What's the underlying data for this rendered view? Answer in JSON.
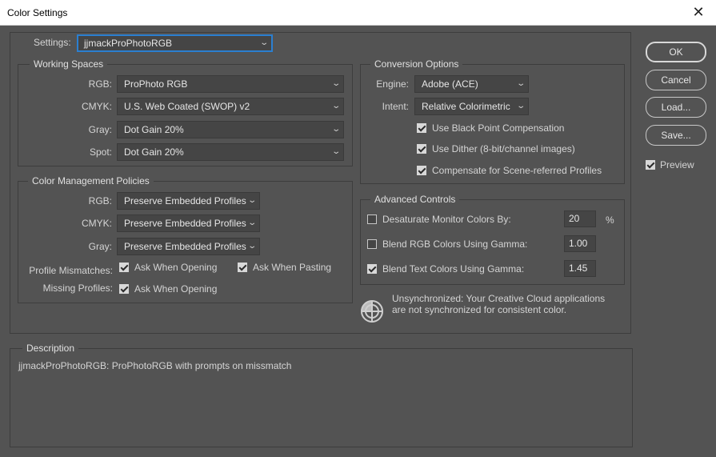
{
  "window": {
    "title": "Color Settings",
    "close_glyph": "✕"
  },
  "settings": {
    "label": "Settings:",
    "value": "jjmackProPhotoRGB"
  },
  "working_spaces": {
    "legend": "Working Spaces",
    "rows": [
      {
        "label": "RGB:",
        "value": "ProPhoto RGB"
      },
      {
        "label": "CMYK:",
        "value": "U.S. Web Coated (SWOP) v2"
      },
      {
        "label": "Gray:",
        "value": "Dot Gain 20%"
      },
      {
        "label": "Spot:",
        "value": "Dot Gain 20%"
      }
    ]
  },
  "policies": {
    "legend": "Color Management Policies",
    "rows": [
      {
        "label": "RGB:",
        "value": "Preserve Embedded Profiles"
      },
      {
        "label": "CMYK:",
        "value": "Preserve Embedded Profiles"
      },
      {
        "label": "Gray:",
        "value": "Preserve Embedded Profiles"
      }
    ],
    "mismatch_label": "Profile Mismatches:",
    "mismatch_opening": {
      "label": "Ask When Opening",
      "checked": true
    },
    "mismatch_pasting": {
      "label": "Ask When Pasting",
      "checked": true
    },
    "missing_label": "Missing Profiles:",
    "missing_opening": {
      "label": "Ask When Opening",
      "checked": true
    }
  },
  "conversion": {
    "legend": "Conversion Options",
    "engine_label": "Engine:",
    "engine_value": "Adobe (ACE)",
    "intent_label": "Intent:",
    "intent_value": "Relative Colorimetric",
    "black_point": {
      "label": "Use Black Point Compensation",
      "checked": true
    },
    "dither": {
      "label": "Use Dither (8-bit/channel images)",
      "checked": true
    },
    "scene": {
      "label": "Compensate for Scene-referred Profiles",
      "checked": true
    }
  },
  "advanced": {
    "legend": "Advanced Controls",
    "desaturate": {
      "label": "Desaturate Monitor Colors By:",
      "checked": false,
      "value": "20",
      "unit": "%"
    },
    "blend_rgb": {
      "label": "Blend RGB Colors Using Gamma:",
      "checked": false,
      "value": "1.00"
    },
    "blend_text": {
      "label": "Blend Text Colors Using Gamma:",
      "checked": true,
      "value": "1.45"
    }
  },
  "sync": {
    "icon": "sync-status-icon",
    "line1": "Unsynchronized: Your Creative Cloud applications",
    "line2": "are not synchronized for consistent color."
  },
  "description": {
    "legend": "Description",
    "text": "jjmackProPhotoRGB:  ProPhotoRGB with prompts on missmatch"
  },
  "buttons": {
    "ok": "OK",
    "cancel": "Cancel",
    "load": "Load...",
    "save": "Save..."
  },
  "preview": {
    "label": "Preview",
    "checked": true
  },
  "colors": {
    "background": "#535353",
    "field": "#454545",
    "focus": "#2b7fd0",
    "border": "#3d3d3d"
  }
}
